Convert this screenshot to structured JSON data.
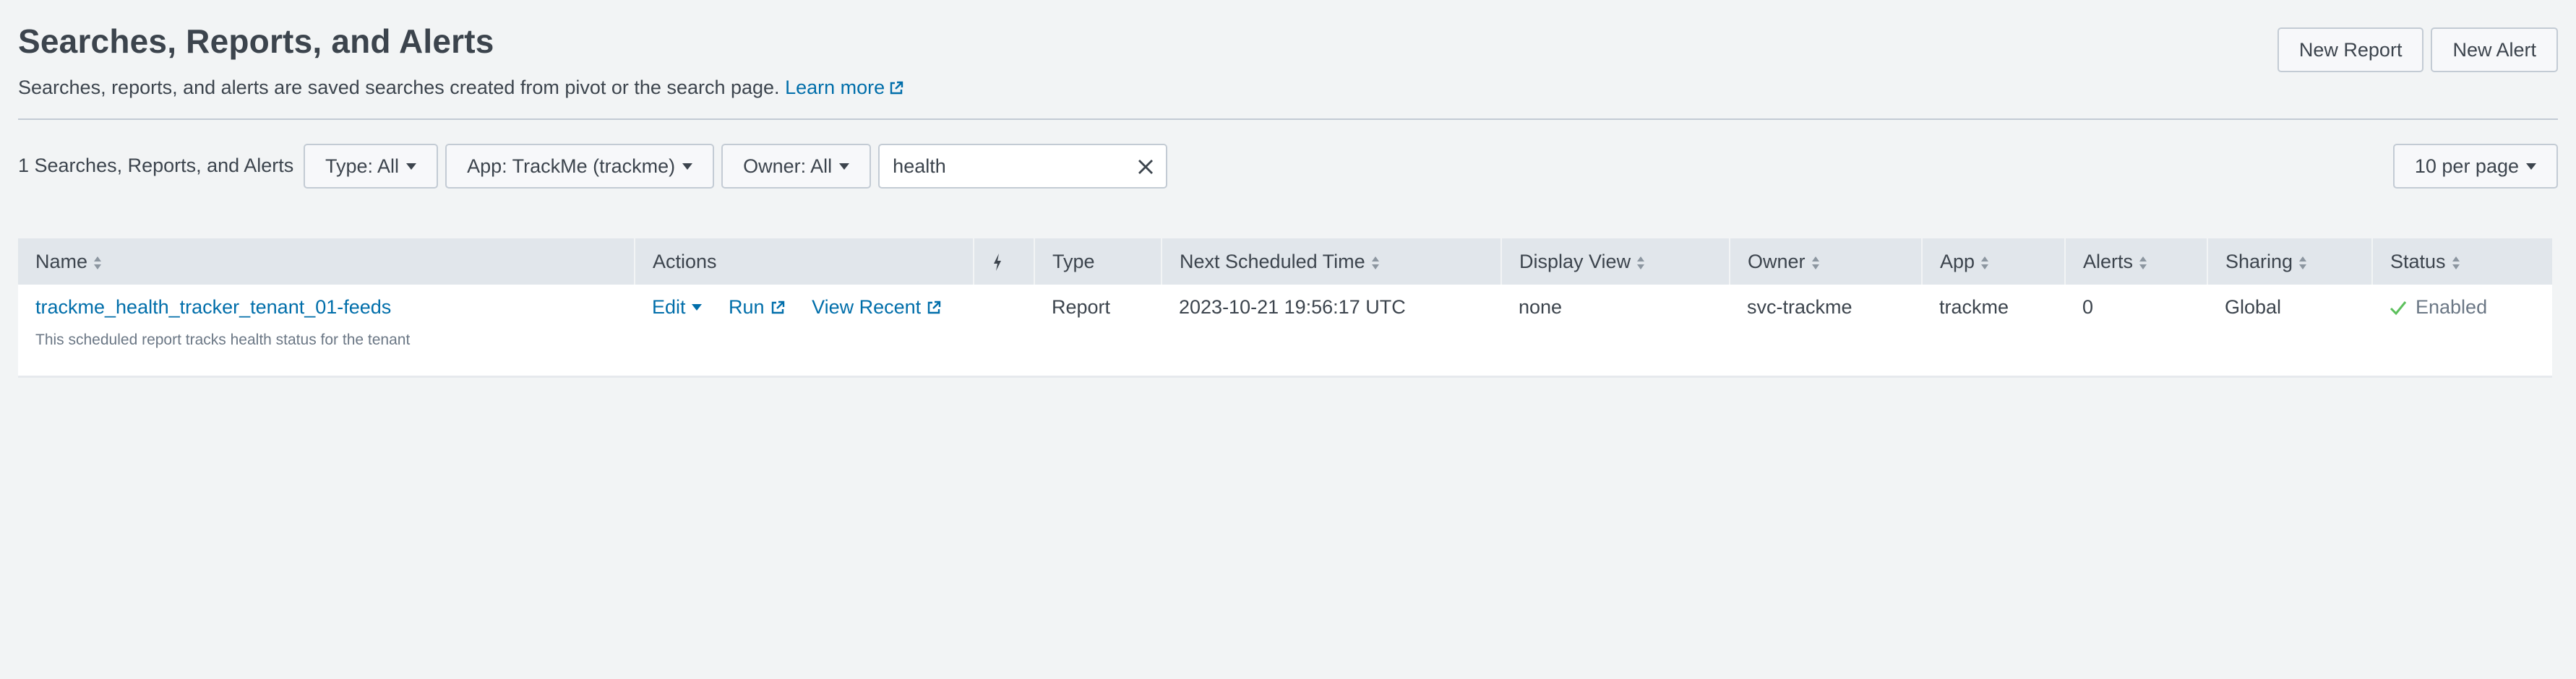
{
  "header": {
    "title": "Searches, Reports, and Alerts",
    "description": "Searches, reports, and alerts are saved searches created from pivot or the search page.",
    "learn_more": "Learn more",
    "new_report": "New Report",
    "new_alert": "New Alert"
  },
  "filters": {
    "count_label": "1 Searches, Reports, and Alerts",
    "type": "Type: All",
    "app": "App: TrackMe (trackme)",
    "owner": "Owner: All",
    "search_value": "health",
    "per_page": "10 per page"
  },
  "table": {
    "columns": {
      "name": "Name",
      "actions": "Actions",
      "type": "Type",
      "next_scheduled": "Next Scheduled Time",
      "display_view": "Display View",
      "owner": "Owner",
      "app": "App",
      "alerts": "Alerts",
      "sharing": "Sharing",
      "status": "Status"
    },
    "rows": [
      {
        "name": "trackme_health_tracker_tenant_01-feeds",
        "description": "This scheduled report tracks health status for the tenant",
        "action_edit": "Edit",
        "action_run": "Run",
        "action_view_recent": "View Recent",
        "type": "Report",
        "next_scheduled": "2023-10-21 19:56:17 UTC",
        "display_view": "none",
        "owner": "svc-trackme",
        "app": "trackme",
        "alerts": "0",
        "sharing": "Global",
        "status": "Enabled"
      }
    ]
  },
  "colors": {
    "background": "#f2f4f5",
    "link": "#006eaa",
    "header_row": "#e1e6eb",
    "status_ok": "#5cc05c"
  }
}
